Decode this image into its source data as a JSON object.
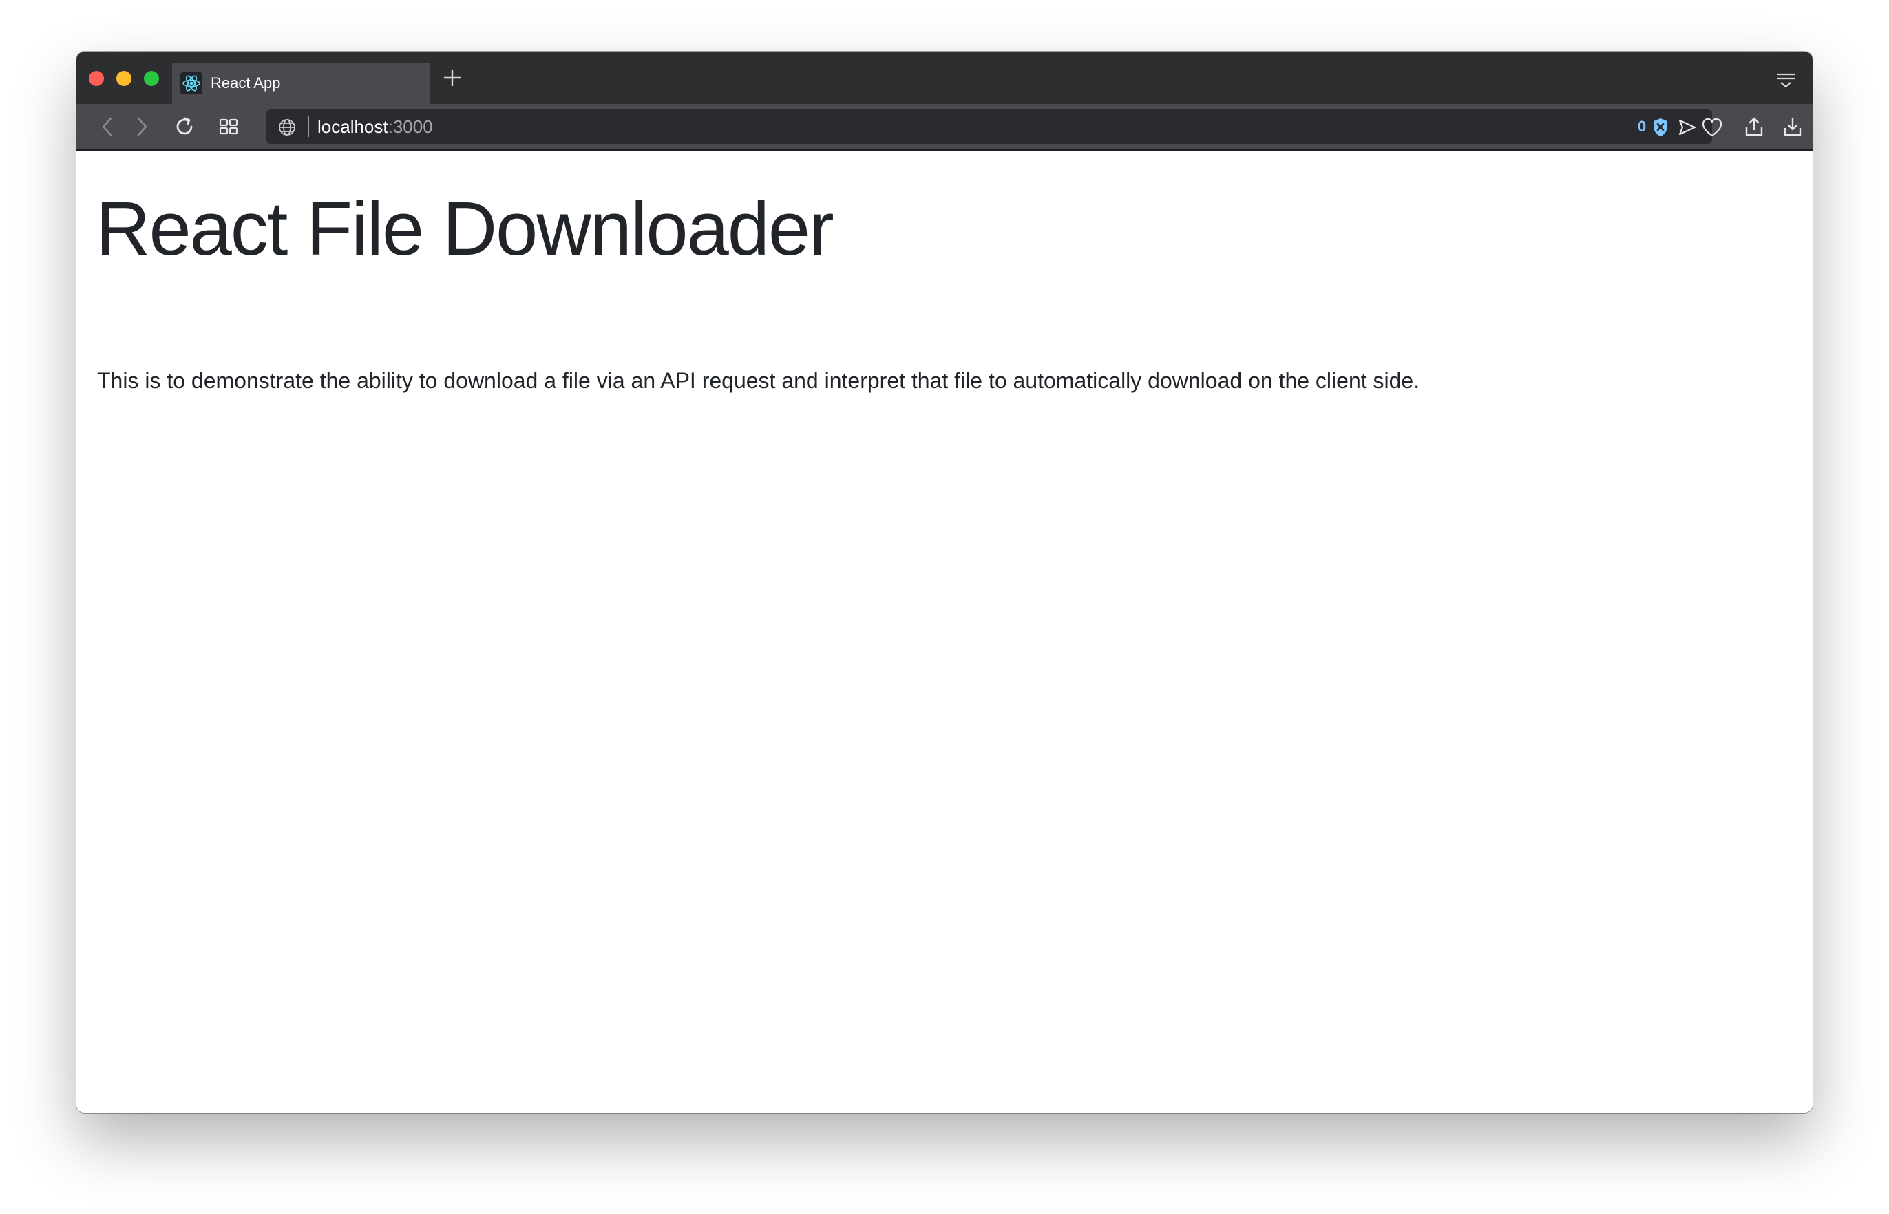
{
  "browser": {
    "tabs": [
      {
        "title": "React App",
        "favicon": "react-logo-icon",
        "active": true
      }
    ],
    "new_tab_icon": "plus-icon",
    "tab_menu_icon": "tab-menu-icon",
    "toolbar": {
      "back_icon": "chevron-left-icon",
      "forward_icon": "chevron-right-icon",
      "reload_icon": "reload-icon",
      "speed_dial_icon": "grid-icon",
      "share_icon": "share-icon",
      "download_icon": "download-icon"
    },
    "address_bar": {
      "host": "localhost",
      "port": ":3000",
      "site_icon": "globe-icon",
      "blocked_count": "0",
      "shield_icon": "shield-icon",
      "send_icon": "send-icon",
      "bookmark_icon": "heart-icon"
    },
    "colors": {
      "titlebar": "#2c2e30",
      "toolbar": "#484a4e",
      "address_bg": "#2a2b2e",
      "accent": "#7fc6ff",
      "close": "#fe5f57",
      "minimize": "#febc2e",
      "maximize": "#28c840"
    }
  },
  "page": {
    "title": "React File Downloader",
    "description": "This is to demonstrate the ability to download a file via an API request and interpret that file to automatically download on the client side."
  }
}
